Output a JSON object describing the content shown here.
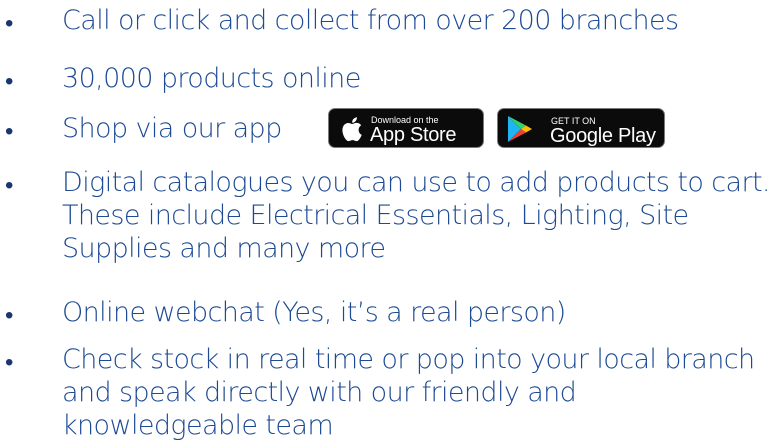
{
  "bullet_glyph": "•",
  "items": [
    {
      "text": "Call or click and collect from over 200 branches"
    },
    {
      "text": "30,000 products online"
    },
    {
      "text": "Shop via our app"
    },
    {
      "text": "Digital catalogues you can use to add products to cart. These include Electrical Essentials, Lighting, Site Supplies and many more"
    },
    {
      "text": "Online webchat (Yes, it’s a real person)"
    },
    {
      "text": "Check stock in real time or pop into your local branch and speak directly with our friendly and knowledgeable team"
    }
  ],
  "badges": {
    "app_store": {
      "small_label": "Download on the",
      "big_label": "App Store",
      "icon": "apple-icon"
    },
    "google_play": {
      "small_label": "GET IT ON",
      "big_label": "Google Play",
      "icon": "google-play-icon"
    }
  },
  "colors": {
    "text": "#1c4a94",
    "bullet": "#1a3670",
    "badge_bg": "#0b0b0b"
  }
}
